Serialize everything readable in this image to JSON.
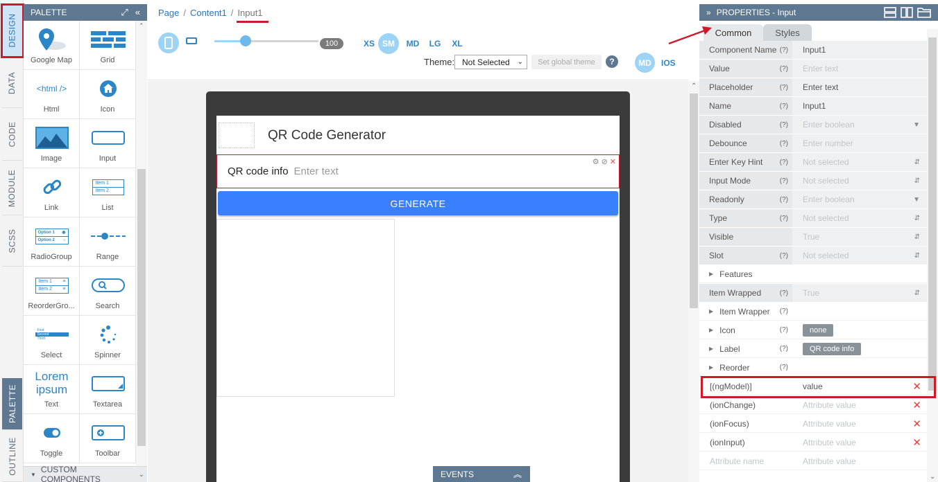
{
  "left_tabs": [
    "DESIGN",
    "DATA",
    "CODE",
    "MODULE",
    "SCSS",
    "PALETTE",
    "OUTLINE"
  ],
  "palette": {
    "title": "PALETTE",
    "items": [
      {
        "label": "Google Map",
        "icon": "map-pin-icon"
      },
      {
        "label": "Grid",
        "icon": "grid-icon"
      },
      {
        "label": "Html",
        "icon": "html-icon",
        "glyph": "<html />"
      },
      {
        "label": "Icon",
        "icon": "home-icon"
      },
      {
        "label": "Image",
        "icon": "image-icon"
      },
      {
        "label": "Input",
        "icon": "input-box-icon"
      },
      {
        "label": "Link",
        "icon": "link-icon"
      },
      {
        "label": "List",
        "icon": "list-icon",
        "glyph1": "Item 1",
        "glyph2": "Item 2"
      },
      {
        "label": "RadioGroup",
        "icon": "radio-group-icon",
        "glyph1": "Option 1",
        "glyph2": "Option 2"
      },
      {
        "label": "Range",
        "icon": "range-slider-icon"
      },
      {
        "label": "ReorderGro...",
        "icon": "reorder-icon",
        "glyph1": "Item 1",
        "glyph2": "Item 2"
      },
      {
        "label": "Search",
        "icon": "search-icon"
      },
      {
        "label": "Select",
        "icon": "select-icon",
        "glyph1": "First",
        "glyph2": "Second",
        "glyph3": "Third"
      },
      {
        "label": "Spinner",
        "icon": "spinner-icon"
      },
      {
        "label": "Text",
        "icon": "text-icon",
        "glyph": "Lorem ipsum"
      },
      {
        "label": "Textarea",
        "icon": "textarea-icon"
      },
      {
        "label": "Toggle",
        "icon": "toggle-icon"
      },
      {
        "label": "Toolbar",
        "icon": "toolbar-icon"
      }
    ],
    "custom_components": "CUSTOM COMPONENTS"
  },
  "breadcrumb": {
    "page": "Page",
    "content": "Content1",
    "input": "Input1",
    "sep": "/"
  },
  "toolbar": {
    "zoom": "100",
    "zoom_fraction": 0.3,
    "sizes": [
      "XS",
      "SM",
      "MD",
      "LG",
      "XL"
    ],
    "active_size": "SM",
    "theme_label": "Theme:",
    "theme_value": "Not Selected",
    "global_theme_button": "Set global theme",
    "help": "?",
    "mode_md": "MD",
    "mode_ios": "IOS"
  },
  "app": {
    "title": "QR Code Generator",
    "input_label": "QR code info",
    "input_placeholder": "Enter text",
    "button": "GENERATE",
    "events": "EVENTS"
  },
  "properties": {
    "title": "PROPERTIES - Input",
    "tabs": [
      "Common",
      "Styles"
    ],
    "rows": [
      {
        "label": "Component Name",
        "help": "(?)",
        "value": "Input1"
      },
      {
        "label": "Value",
        "help": "(?)",
        "placeholder": "Enter text"
      },
      {
        "label": "Placeholder",
        "help": "(?)",
        "value": "Enter text"
      },
      {
        "label": "Name",
        "help": "(?)",
        "value": "Input1"
      },
      {
        "label": "Disabled",
        "help": "(?)",
        "placeholder": "Enter boolean",
        "control": "dropdown"
      },
      {
        "label": "Debounce",
        "help": "(?)",
        "placeholder": "Enter number"
      },
      {
        "label": "Enter Key Hint",
        "help": "(?)",
        "placeholder": "Not selected",
        "control": "spinner"
      },
      {
        "label": "Input Mode",
        "help": "(?)",
        "placeholder": "Not selected",
        "control": "spinner"
      },
      {
        "label": "Readonly",
        "help": "(?)",
        "placeholder": "Enter boolean",
        "control": "dropdown"
      },
      {
        "label": "Type",
        "help": "(?)",
        "placeholder": "Not selected",
        "control": "spinner"
      },
      {
        "label": "Visible",
        "help": "",
        "placeholder": "True",
        "control": "spinner"
      },
      {
        "label": "Slot",
        "help": "(?)",
        "placeholder": "Not selected",
        "control": "spinner"
      },
      {
        "label": "Features",
        "help": "",
        "expandable": true
      },
      {
        "label": "Item Wrapped",
        "help": "(?)",
        "placeholder": "True",
        "control": "spinner"
      },
      {
        "label": "Item Wrapper",
        "help": "(?)",
        "expandable": true
      },
      {
        "label": "Icon",
        "help": "(?)",
        "expandable": true,
        "badge": "none"
      },
      {
        "label": "Label",
        "help": "(?)",
        "expandable": true,
        "badge": "QR code info"
      },
      {
        "label": "Reorder",
        "help": "(?)",
        "expandable": true
      }
    ],
    "attributes": [
      {
        "label": "[(ngModel)]",
        "value": "value",
        "removable": true
      },
      {
        "label": "(ionChange)",
        "placeholder": "Attribute value",
        "removable": true
      },
      {
        "label": "(ionFocus)",
        "placeholder": "Attribute value",
        "removable": true
      },
      {
        "label": "(ionInput)",
        "placeholder": "Attribute value",
        "removable": true
      },
      {
        "label_placeholder": "Attribute name",
        "placeholder": "Attribute value"
      }
    ]
  },
  "colors": {
    "accent": "#2a76b7",
    "header": "#5e7891",
    "highlight": "#cc1a2a",
    "button": "#3880ff"
  }
}
